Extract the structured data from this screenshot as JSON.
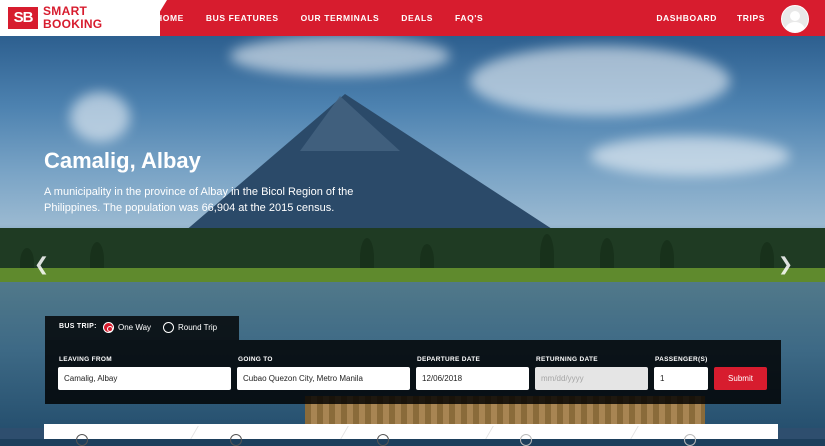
{
  "brand": {
    "mark": "SB",
    "line1": "SMART",
    "line2": "BOOKING",
    "color": "#d71c2e"
  },
  "nav": {
    "left": [
      "HOME",
      "BUS FEATURES",
      "OUR TERMINALS",
      "DEALS",
      "FAQ'S"
    ],
    "right": [
      "DASHBOARD",
      "TRIPS"
    ]
  },
  "hero": {
    "title": "Camalig, Albay",
    "description": "A municipality in the province of Albay in the Bicol Region of the Philippines. The population was 66,904 at the 2015 census.",
    "prev_icon": "chevron-left-icon",
    "next_icon": "chevron-right-icon"
  },
  "booking": {
    "trip_label": "BUS TRIP:",
    "options": [
      "One Way",
      "Round Trip"
    ],
    "selected": "One Way",
    "fields": {
      "leaving_label": "LEAVING FROM",
      "leaving_value": "Camalig, Albay",
      "going_label": "GOING TO",
      "going_value": "Cubao Quezon City, Metro Manila",
      "departure_label": "DEPARTURE DATE",
      "departure_value": "12/06/2018",
      "returning_label": "RETURNING DATE",
      "returning_placeholder": "mm/dd/yyyy",
      "passengers_label": "PASSENGER(S)",
      "passengers_value": "1"
    },
    "submit_label": "Submit"
  }
}
